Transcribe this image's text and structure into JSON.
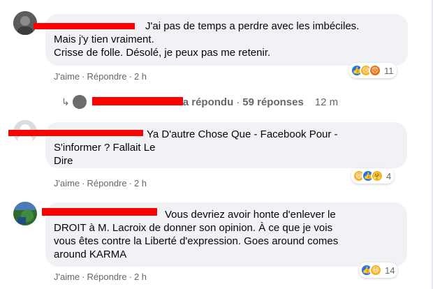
{
  "comments": [
    {
      "text_lines": [
        "J'ai pas de temps a perdre avec les imbéciles.",
        "Mais j'y tien vraiment.",
        "Crisse de folle. Désolé, je peux pas me retenir."
      ],
      "like": "J'aime",
      "reply": "Répondre",
      "time": "2 h",
      "reaction_count": "11",
      "reactions": [
        "like-icon",
        "sad-icon",
        "angry-icon"
      ]
    },
    {
      "text_lines": [
        "Ya D'autre Chose Que - Facebook Pour -",
        "S'informer ? Fallait Le",
        "Dire"
      ],
      "like": "J'aime",
      "reply": "Répondre",
      "time": "2 h",
      "reaction_count": "4",
      "reactions": [
        "haha-icon",
        "like-icon",
        "care-icon"
      ]
    },
    {
      "text_lines": [
        "Vous devriez avoir honte d'enlever le",
        "DROIT à M. Lacroix de donner son opinion. À ce que je vois",
        "vous êtes contre la Liberté d'expression. Goes around comes",
        "around KARMA"
      ],
      "like": "J'aime",
      "reply": "Répondre",
      "time": "2 h",
      "reaction_count": "14",
      "reactions": [
        "like-icon",
        "haha-icon"
      ]
    }
  ],
  "reply_summary": {
    "replied": "a répondu",
    "replies": "59 réponses",
    "time": "12 m"
  },
  "colors": {
    "bubble": "#f0f2f5",
    "redaction": "#ff0000",
    "secondary_text": "#65676b"
  }
}
